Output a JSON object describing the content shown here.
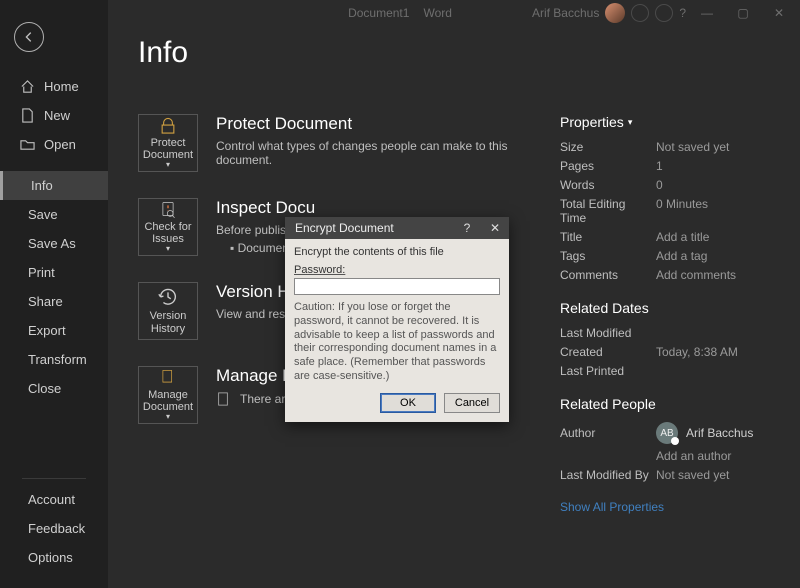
{
  "titlebar": {
    "doc": "Document1",
    "app": "Word",
    "user": "Arif Bacchus"
  },
  "sidebar": {
    "back": "Back",
    "home": "Home",
    "new": "New",
    "open": "Open",
    "info": "Info",
    "save": "Save",
    "saveas": "Save As",
    "print": "Print",
    "share": "Share",
    "export": "Export",
    "transform": "Transform",
    "close": "Close",
    "account": "Account",
    "feedback": "Feedback",
    "options": "Options"
  },
  "page": {
    "title": "Info"
  },
  "tiles": {
    "protect": "Protect Document",
    "check": "Check for Issues",
    "version": "Version History",
    "manage": "Manage Document"
  },
  "sections": {
    "protect": {
      "title": "Protect Document",
      "desc": "Control what types of changes people can make to this document."
    },
    "inspect": {
      "title": "Inspect Docu",
      "lead": "Before publishing th",
      "bullet": "Document pro"
    },
    "version": {
      "title": "Version Histo",
      "desc": "View and restore pr"
    },
    "manage": {
      "title": "Manage Document",
      "desc": "There are no unsaved changes."
    }
  },
  "properties": {
    "header": "Properties",
    "size_label": "Size",
    "size_value": "Not saved yet",
    "pages_label": "Pages",
    "pages_value": "1",
    "words_label": "Words",
    "words_value": "0",
    "editingtime_label": "Total Editing Time",
    "editingtime_value": "0 Minutes",
    "title_label": "Title",
    "title_value": "Add a title",
    "tags_label": "Tags",
    "tags_value": "Add a tag",
    "comments_label": "Comments",
    "comments_value": "Add comments",
    "dates_header": "Related Dates",
    "lastmod_label": "Last Modified",
    "lastmod_value": "",
    "created_label": "Created",
    "created_value": "Today, 8:38 AM",
    "lastprint_label": "Last Printed",
    "lastprint_value": "",
    "people_header": "Related People",
    "author_label": "Author",
    "author_initials": "AB",
    "author_name": "Arif Bacchus",
    "add_author": "Add an author",
    "modifiedby_label": "Last Modified By",
    "modifiedby_value": "Not saved yet",
    "show_all": "Show All Properties"
  },
  "dialog": {
    "title": "Encrypt Document",
    "intro": "Encrypt the contents of this file",
    "pw_label": "Password:",
    "pw_value": "",
    "caution": "Caution: If you lose or forget the password, it cannot be recovered. It is advisable to keep a list of passwords and their corresponding document names in a safe place.\n(Remember that passwords are case-sensitive.)",
    "ok": "OK",
    "cancel": "Cancel"
  }
}
